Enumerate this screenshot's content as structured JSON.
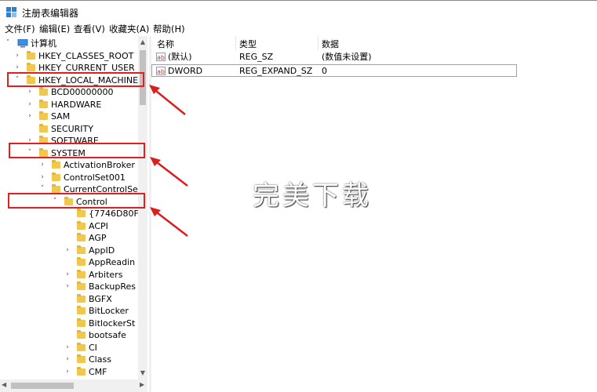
{
  "window": {
    "title": "注册表编辑器"
  },
  "menu": [
    "文件(F)",
    "编辑(E)",
    "查看(V)",
    "收藏夹(A)",
    "帮助(H)"
  ],
  "tree": {
    "root": "计算机",
    "nodes": [
      {
        "label": "HKEY_CLASSES_ROOT",
        "expander": "›"
      },
      {
        "label": "HKEY_CURRENT_USER",
        "expander": "›"
      },
      {
        "label": "HKEY_LOCAL_MACHINE",
        "expander": "˅"
      },
      {
        "label": "BCD00000000",
        "expander": "›"
      },
      {
        "label": "HARDWARE",
        "expander": "›"
      },
      {
        "label": "SAM",
        "expander": "›"
      },
      {
        "label": "SECURITY",
        "expander": ""
      },
      {
        "label": "SOFTWARE",
        "expander": "›"
      },
      {
        "label": "SYSTEM",
        "expander": "˅"
      },
      {
        "label": "ActivationBroker",
        "expander": "›"
      },
      {
        "label": "ControlSet001",
        "expander": "›"
      },
      {
        "label": "CurrentControlSe",
        "expander": "˅"
      },
      {
        "label": "Control",
        "expander": "˅"
      },
      {
        "label": "{7746D80F",
        "expander": ""
      },
      {
        "label": "ACPI",
        "expander": ""
      },
      {
        "label": "AGP",
        "expander": ""
      },
      {
        "label": "AppID",
        "expander": "›"
      },
      {
        "label": "AppReadin",
        "expander": ""
      },
      {
        "label": "Arbiters",
        "expander": "›"
      },
      {
        "label": "BackupRes",
        "expander": "›"
      },
      {
        "label": "BGFX",
        "expander": ""
      },
      {
        "label": "BitLocker",
        "expander": ""
      },
      {
        "label": "BitlockerSt",
        "expander": ""
      },
      {
        "label": "bootsafe",
        "expander": ""
      },
      {
        "label": "CI",
        "expander": "›"
      },
      {
        "label": "Class",
        "expander": "›"
      },
      {
        "label": "CMF",
        "expander": "›"
      }
    ]
  },
  "list": {
    "headers": [
      "名称",
      "类型",
      "数据"
    ],
    "rows": [
      {
        "icon": "ab",
        "name": "(默认)",
        "type": "REG_SZ",
        "data": "(数值未设置)"
      },
      {
        "icon": "ab",
        "name": "DWORD",
        "type": "REG_EXPAND_SZ",
        "data": "0"
      }
    ]
  },
  "watermark": "完美下载",
  "colors": {
    "highlight": "#e02020",
    "folder": "#f0c850"
  }
}
